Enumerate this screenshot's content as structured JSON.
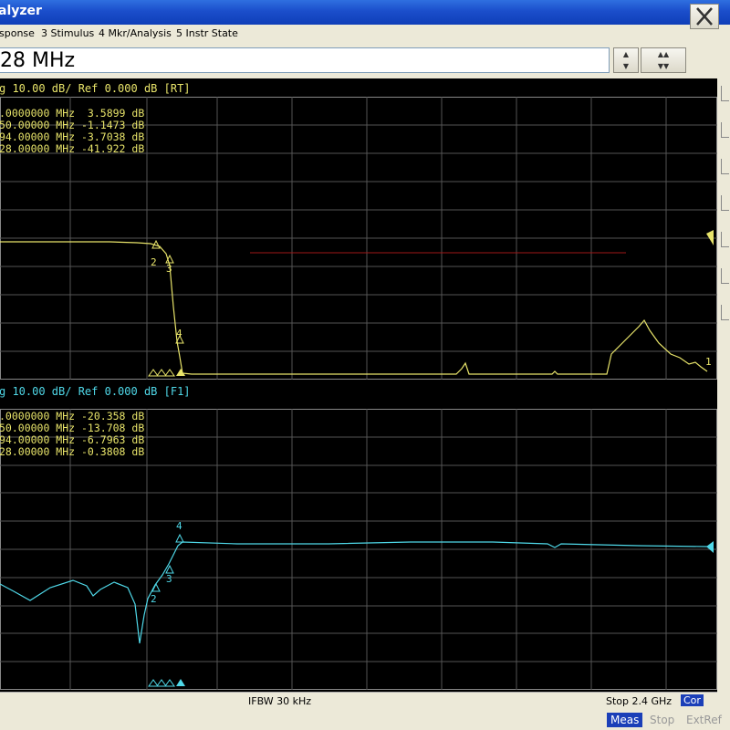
{
  "window": {
    "title": "alyzer"
  },
  "menu": {
    "items": [
      "sponse",
      "3 Stimulus",
      "4 Mkr/Analysis",
      "5 Instr State"
    ]
  },
  "entry": {
    "value": "28 MHz"
  },
  "colors": {
    "trace1": "#e8e46a",
    "trace2": "#4fd8e8",
    "grid": "#555555",
    "limit": "#a01818"
  },
  "trace1": {
    "header": "g 10.00 dB/ Ref 0.000 dB [RT]",
    "markers": [
      ".0000000 MHz  3.5899 dB",
      "50.00000 MHz -1.1473 dB",
      "94.00000 MHz -3.7038 dB",
      "28.00000 MHz -41.922 dB"
    ],
    "marker_labels": [
      "1",
      "2",
      "3",
      "4"
    ]
  },
  "trace2": {
    "header": "g 10.00 dB/ Ref 0.000 dB [F1]",
    "markers": [
      ".0000000 MHz -20.358 dB",
      "50.00000 MHz -13.708 dB",
      "94.00000 MHz -6.7963 dB",
      "28.00000 MHz -0.3808 dB"
    ],
    "marker_labels": [
      "2",
      "3",
      "4"
    ]
  },
  "status": {
    "ifbw": "IFBW 30 kHz",
    "stop": "Stop 2.4 GHz",
    "cor": "Cor"
  },
  "bottom": {
    "meas": "Meas",
    "stop": "Stop",
    "extref": "ExtRef"
  }
}
